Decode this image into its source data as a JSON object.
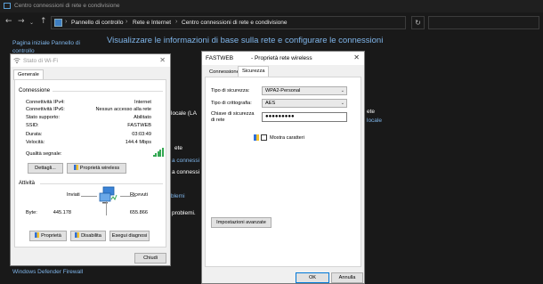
{
  "control_panel": {
    "window_title": "Centro connessioni di rete e condivisione",
    "breadcrumbs": [
      "Pannello di controllo",
      "Rete e Internet",
      "Centro connessioni di rete e condivisione"
    ],
    "sidebar_home_line1": "Pagina iniziale Pannello di",
    "sidebar_home_line2": "controllo",
    "heading": "Visualizzare le informazioni di base sulla rete e configurare le connessioni",
    "frag_locale_label": "locale (LA",
    "frag_ete": "ete",
    "frag_connessi": "a connessi",
    "frag_conn2": "a connessi",
    "frag_blemi": "blemi",
    "frag_problemi": "problemi.",
    "frag_ete_right": "ete",
    "frag_locale_right": "locale",
    "defender_link": "Windows Defender Firewall"
  },
  "wifi_status": {
    "title": "Stato di Wi-Fi",
    "tab": "Generale",
    "connection_group": "Connessione",
    "rows": [
      {
        "label": "Connettività IPv4:",
        "value": "Internet"
      },
      {
        "label": "Connettività IPv6:",
        "value": "Nessun accesso alla rete"
      },
      {
        "label": "Stato supporto:",
        "value": "Abilitato"
      },
      {
        "label": "SSID:",
        "value": "FASTWEB"
      },
      {
        "label": "Durata:",
        "value": "03:03:49"
      },
      {
        "label": "Velocità:",
        "value": "144.4 Mbps"
      }
    ],
    "signal_label": "Qualità segnale:",
    "signal_level": 5,
    "details_button": "Dettagli...",
    "wireless_props_button": "Proprietà wireless",
    "activity_group": "Attività",
    "sent_label": "Inviati",
    "received_label": "Ricevuti",
    "bytes_label": "Byte:",
    "bytes_sent": "445.178",
    "bytes_received": "655.866",
    "properties_button": "Proprietà",
    "disable_button": "Disabilita",
    "diagnose_button": "Esegui diagnosi",
    "close_button": "Chiudi"
  },
  "wireless_props": {
    "title": "FASTWEB",
    "subtitle": "- Proprietà rete wireless",
    "tabs": [
      "Connessione",
      "Sicurezza"
    ],
    "active_tab": "Sicurezza",
    "security_type_label": "Tipo di sicurezza:",
    "security_type_value": "WPA2-Personal",
    "encryption_label": "Tipo di crittografia:",
    "encryption_value": "AES",
    "key_label_line1": "Chiave di sicurezza",
    "key_label_line2": "di rete",
    "key_value": "●●●●●●●●●",
    "show_chars_label": "Mostra caratteri",
    "show_chars_checked": false,
    "advanced_button": "Impostazioni avanzate",
    "ok_button": "OK",
    "cancel_button": "Annulla"
  }
}
